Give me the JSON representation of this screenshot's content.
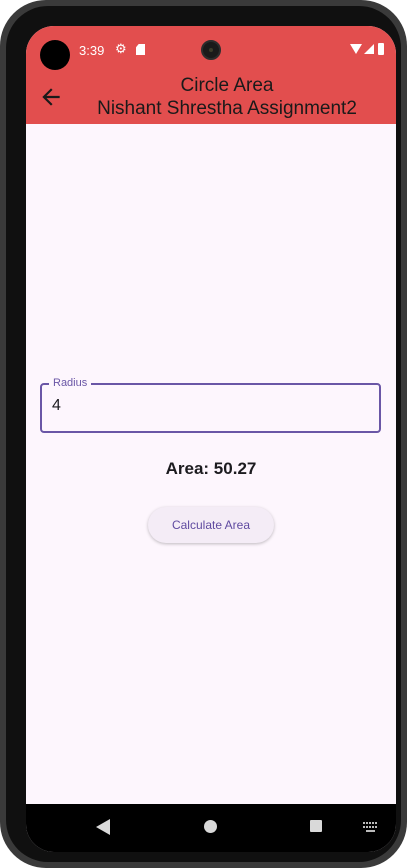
{
  "status_bar": {
    "time": "3:39",
    "icons": [
      "gear-icon",
      "sd-card-icon",
      "wifi-icon",
      "signal-icon",
      "battery-icon"
    ]
  },
  "app_bar": {
    "title_line1": "Circle Area",
    "title_line2": "Nishant Shrestha Assignment2",
    "background_color": "#e24e4e"
  },
  "form": {
    "radius_label": "Radius",
    "radius_value": "4",
    "accent_color": "#6a56a6"
  },
  "result": {
    "area_text": "Area: 50.27"
  },
  "actions": {
    "calculate_label": "Calculate Area"
  },
  "nav_bar": {
    "buttons": [
      "back",
      "home",
      "recents",
      "keyboard"
    ]
  }
}
